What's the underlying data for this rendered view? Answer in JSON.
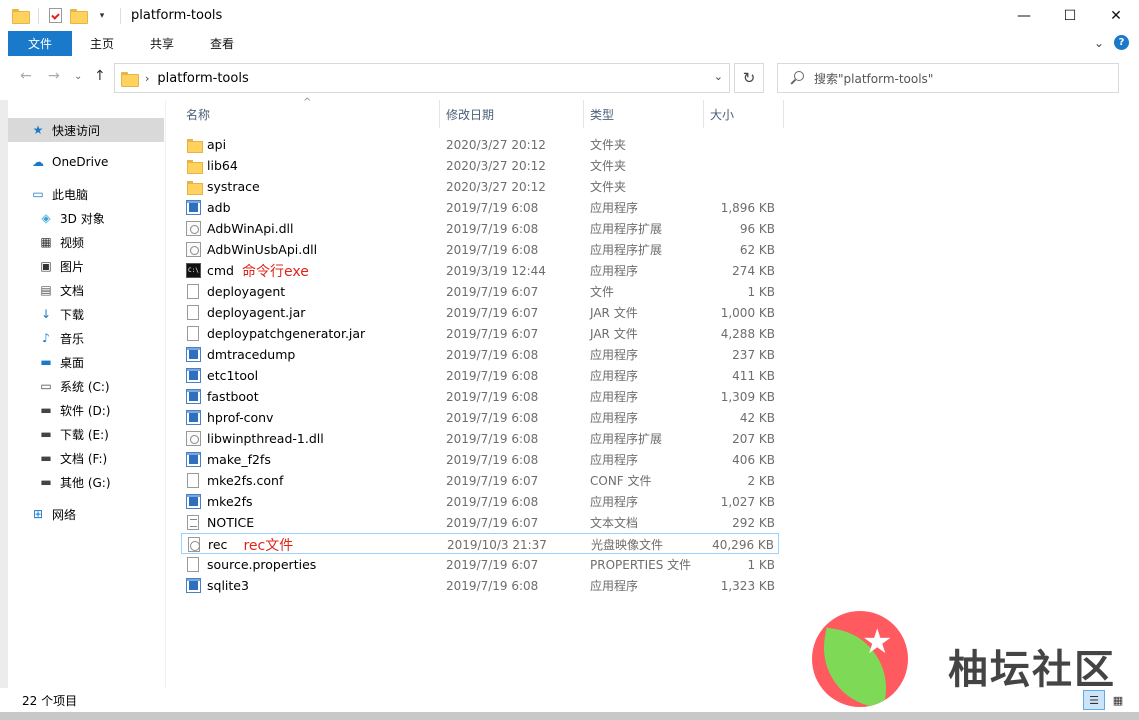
{
  "window": {
    "title": "platform-tools",
    "controls": {
      "minimize": "—",
      "maximize": "☐",
      "close": "✕"
    }
  },
  "ribbon": {
    "tabs": [
      "文件",
      "主页",
      "共享",
      "查看"
    ],
    "expand": "⌄",
    "help": "?"
  },
  "address": {
    "back": "←",
    "forward": "→",
    "recent": "⌄",
    "up": "↑",
    "crumb": "platform-tools",
    "crumb_sep": "›",
    "dropdown": "⌄",
    "refresh": "↻",
    "search_placeholder": "搜索\"platform-tools\""
  },
  "nav": {
    "items": [
      {
        "label": "快速访问",
        "icon": "star-icon",
        "glyph": "★",
        "color": "#1979ca",
        "selected": true
      },
      {
        "label": "OneDrive",
        "icon": "cloud-icon",
        "glyph": "☁",
        "color": "#1979ca"
      },
      {
        "label": "此电脑",
        "icon": "computer-icon",
        "glyph": "▭",
        "color": "#1979ca"
      },
      {
        "label": "3D 对象",
        "icon": "cube-icon",
        "glyph": "◈",
        "color": "#3aa3d8"
      },
      {
        "label": "视频",
        "icon": "film-icon",
        "glyph": "▦",
        "color": "#333"
      },
      {
        "label": "图片",
        "icon": "picture-icon",
        "glyph": "▣",
        "color": "#333"
      },
      {
        "label": "文档",
        "icon": "document-icon",
        "glyph": "▤",
        "color": "#555"
      },
      {
        "label": "下载",
        "icon": "download-icon",
        "glyph": "↓",
        "color": "#1979ca"
      },
      {
        "label": "音乐",
        "icon": "music-icon",
        "glyph": "♪",
        "color": "#1979ca"
      },
      {
        "label": "桌面",
        "icon": "desktop-icon",
        "glyph": "▬",
        "color": "#1979ca"
      },
      {
        "label": "系统 (C:)",
        "icon": "windows-drive-icon",
        "glyph": "▭",
        "color": "#444"
      },
      {
        "label": "软件 (D:)",
        "icon": "drive-icon",
        "glyph": "▬",
        "color": "#444"
      },
      {
        "label": "下载 (E:)",
        "icon": "drive-icon",
        "glyph": "▬",
        "color": "#444"
      },
      {
        "label": "文档 (F:)",
        "icon": "drive-icon",
        "glyph": "▬",
        "color": "#444"
      },
      {
        "label": "其他 (G:)",
        "icon": "drive-icon",
        "glyph": "▬",
        "color": "#444"
      },
      {
        "label": "网络",
        "icon": "network-icon",
        "glyph": "⊞",
        "color": "#1979ca"
      }
    ]
  },
  "columns": {
    "name": "名称",
    "date": "修改日期",
    "type": "类型",
    "size": "大小",
    "sort_indicator": "^"
  },
  "files": [
    {
      "name": "api",
      "date": "2020/3/27 20:12",
      "type": "文件夹",
      "size": "",
      "icon": "folder"
    },
    {
      "name": "lib64",
      "date": "2020/3/27 20:12",
      "type": "文件夹",
      "size": "",
      "icon": "folder"
    },
    {
      "name": "systrace",
      "date": "2020/3/27 20:12",
      "type": "文件夹",
      "size": "",
      "icon": "folder"
    },
    {
      "name": "adb",
      "date": "2019/7/19 6:08",
      "type": "应用程序",
      "size": "1,896 KB",
      "icon": "app"
    },
    {
      "name": "AdbWinApi.dll",
      "date": "2019/7/19 6:08",
      "type": "应用程序扩展",
      "size": "96 KB",
      "icon": "dll"
    },
    {
      "name": "AdbWinUsbApi.dll",
      "date": "2019/7/19 6:08",
      "type": "应用程序扩展",
      "size": "62 KB",
      "icon": "dll"
    },
    {
      "name": "cmd",
      "date": "2019/3/19 12:44",
      "type": "应用程序",
      "size": "274 KB",
      "icon": "cmd",
      "annotation": "命令行exe"
    },
    {
      "name": "deployagent",
      "date": "2019/7/19 6:07",
      "type": "文件",
      "size": "1 KB",
      "icon": "file"
    },
    {
      "name": "deployagent.jar",
      "date": "2019/7/19 6:07",
      "type": "JAR 文件",
      "size": "1,000 KB",
      "icon": "file"
    },
    {
      "name": "deploypatchgenerator.jar",
      "date": "2019/7/19 6:07",
      "type": "JAR 文件",
      "size": "4,288 KB",
      "icon": "file"
    },
    {
      "name": "dmtracedump",
      "date": "2019/7/19 6:08",
      "type": "应用程序",
      "size": "237 KB",
      "icon": "app"
    },
    {
      "name": "etc1tool",
      "date": "2019/7/19 6:08",
      "type": "应用程序",
      "size": "411 KB",
      "icon": "app"
    },
    {
      "name": "fastboot",
      "date": "2019/7/19 6:08",
      "type": "应用程序",
      "size": "1,309 KB",
      "icon": "app"
    },
    {
      "name": "hprof-conv",
      "date": "2019/7/19 6:08",
      "type": "应用程序",
      "size": "42 KB",
      "icon": "app"
    },
    {
      "name": "libwinpthread-1.dll",
      "date": "2019/7/19 6:08",
      "type": "应用程序扩展",
      "size": "207 KB",
      "icon": "dll"
    },
    {
      "name": "make_f2fs",
      "date": "2019/7/19 6:08",
      "type": "应用程序",
      "size": "406 KB",
      "icon": "app"
    },
    {
      "name": "mke2fs.conf",
      "date": "2019/7/19 6:07",
      "type": "CONF 文件",
      "size": "2 KB",
      "icon": "file"
    },
    {
      "name": "mke2fs",
      "date": "2019/7/19 6:08",
      "type": "应用程序",
      "size": "1,027 KB",
      "icon": "app"
    },
    {
      "name": "NOTICE",
      "date": "2019/7/19 6:07",
      "type": "文本文档",
      "size": "292 KB",
      "icon": "text"
    },
    {
      "name": "rec",
      "date": "2019/10/3 21:37",
      "type": "光盘映像文件",
      "size": "40,296 KB",
      "icon": "disc",
      "annotation": "rec文件",
      "highlighted": true
    },
    {
      "name": "source.properties",
      "date": "2019/7/19 6:07",
      "type": "PROPERTIES 文件",
      "size": "1 KB",
      "icon": "file"
    },
    {
      "name": "sqlite3",
      "date": "2019/7/19 6:08",
      "type": "应用程序",
      "size": "1,323 KB",
      "icon": "app"
    }
  ],
  "status": {
    "item_count": "22 个项目"
  },
  "view_buttons": [
    "☰",
    "▦"
  ],
  "watermark": {
    "text": "柚坛社区",
    "star": "★"
  },
  "colors": {
    "accent": "#1979ca",
    "annotation": "#e0241b",
    "selection": "#d9d9d9",
    "highlight_border": "#99d1ff"
  }
}
